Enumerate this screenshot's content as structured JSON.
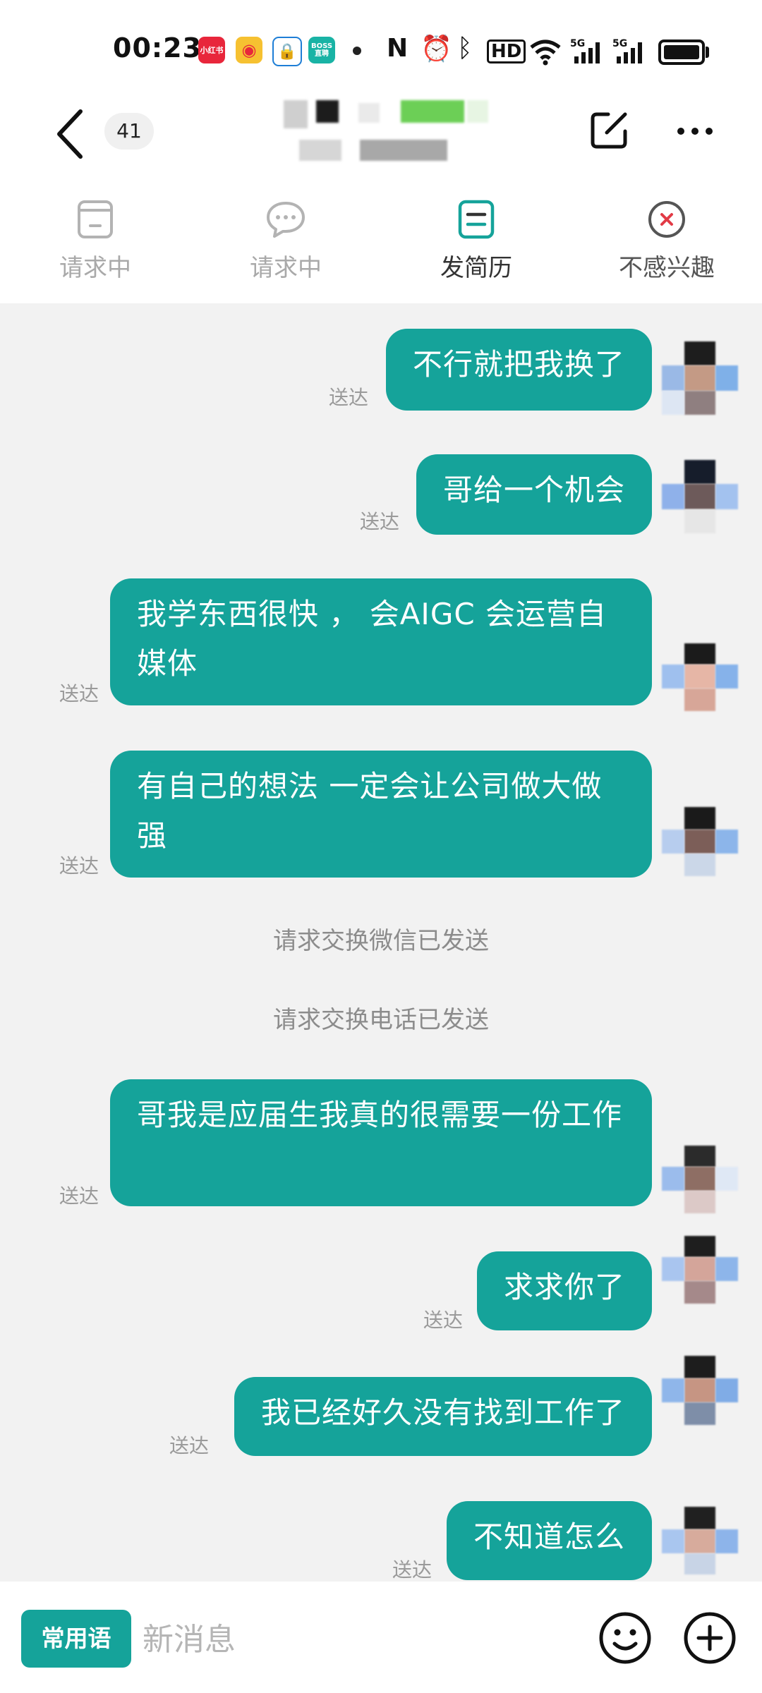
{
  "status_bar": {
    "time": "00:23",
    "apps": [
      "小红书",
      "微博",
      "锁",
      "BOSS直聘"
    ],
    "network": "5G"
  },
  "header": {
    "unread_count": "41"
  },
  "actions": [
    {
      "label": "请求中",
      "icon": "resume-request-icon",
      "active": false
    },
    {
      "label": "请求中",
      "icon": "chat-bubble-icon",
      "active": false
    },
    {
      "label": "发简历",
      "icon": "send-resume-icon",
      "active": true
    },
    {
      "label": "不感兴趣",
      "icon": "not-interested-icon",
      "active": false
    }
  ],
  "messages": [
    {
      "text": "不行就把我换了",
      "status": "送达"
    },
    {
      "text": "哥给一个机会",
      "status": "送达"
    },
    {
      "text": "我学东西很快 ， 会AIGC 会运营自媒体",
      "status": "送达"
    },
    {
      "text": "有自己的想法   一定会让公司做大做强",
      "status": "送达"
    },
    {
      "text": "哥我是应届生我真的很需要一份工作",
      "status": "送达"
    },
    {
      "text": "求求你了",
      "status": "送达"
    },
    {
      "text": "我已经好久没有找到工作了",
      "status": "送达"
    },
    {
      "text": "不知道怎么",
      "status": "送达"
    }
  ],
  "system_messages": [
    "请求交换微信已发送",
    "请求交换电话已发送"
  ],
  "input_bar": {
    "phrases_label": "常用语",
    "placeholder": "新消息"
  },
  "colors": {
    "accent": "#15a39a",
    "chat_background": "#f2f2f2",
    "inactive_text": "#a9a9a9"
  }
}
